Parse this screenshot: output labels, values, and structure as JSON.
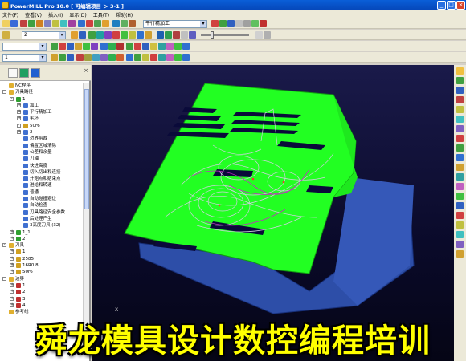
{
  "window": {
    "title": "PowerMILL Pro 10.0   [ 可编辑项目 ＞ 3-1 ]",
    "minimize": "_",
    "maximize": "□",
    "close": "×"
  },
  "menu": [
    "文件(F)",
    "查看(V)",
    "插入(I)",
    "显示(D)",
    "工具(T)",
    "帮助(H)"
  ],
  "toolbar": {
    "strategy_dropdown": "平行精加工",
    "layer_dropdown": "2",
    "tool_dropdown": "1"
  },
  "tree": {
    "rows": [
      {
        "level": 0,
        "exp": "",
        "label": "NC程序",
        "icon": "folder"
      },
      {
        "level": 0,
        "exp": "-",
        "label": "刀具路径",
        "icon": "folder"
      },
      {
        "level": 1,
        "exp": "-",
        "label": "1",
        "icon": "toolpath"
      },
      {
        "level": 2,
        "exp": "+",
        "label": "加工",
        "icon": "gear"
      },
      {
        "level": 2,
        "exp": "+",
        "label": "平行精加工",
        "icon": "gear"
      },
      {
        "level": 2,
        "exp": "+",
        "label": "毛坯",
        "icon": "gear"
      },
      {
        "level": 2,
        "exp": "-",
        "label": "50r6",
        "icon": "tool"
      },
      {
        "level": 2,
        "exp": "+",
        "label": "2",
        "icon": "gear"
      },
      {
        "level": 2,
        "exp": "",
        "label": "边界剪裁",
        "icon": "gear"
      },
      {
        "level": 2,
        "exp": "",
        "label": "偏置区域清除",
        "icon": "gear"
      },
      {
        "level": 2,
        "exp": "",
        "label": "公差和余量",
        "icon": "gear"
      },
      {
        "level": 2,
        "exp": "",
        "label": "刀轴",
        "icon": "gear"
      },
      {
        "level": 2,
        "exp": "",
        "label": "快进高度",
        "icon": "gear"
      },
      {
        "level": 2,
        "exp": "",
        "label": "切入切出和连接",
        "icon": "gear"
      },
      {
        "level": 2,
        "exp": "",
        "label": "开始点和结束点",
        "icon": "gear"
      },
      {
        "level": 2,
        "exp": "",
        "label": "进给和转速",
        "icon": "gear"
      },
      {
        "level": 2,
        "exp": "",
        "label": "普通",
        "icon": "gear"
      },
      {
        "level": 2,
        "exp": "",
        "label": "自动碰撞避让",
        "icon": "gear"
      },
      {
        "level": 2,
        "exp": "",
        "label": "自动检查",
        "icon": "gear"
      },
      {
        "level": 2,
        "exp": "",
        "label": "刀具路径安全参数",
        "icon": "gear"
      },
      {
        "level": 2,
        "exp": "",
        "label": "后处理产生",
        "icon": "gear"
      },
      {
        "level": 2,
        "exp": "",
        "label": "3高度刀具 (32)",
        "icon": "gear"
      },
      {
        "level": 1,
        "exp": "+",
        "label": "1_1",
        "icon": "toolpath"
      },
      {
        "level": 1,
        "exp": "+",
        "label": "2",
        "icon": "toolpath"
      },
      {
        "level": 0,
        "exp": "-",
        "label": "刀具",
        "icon": "folder"
      },
      {
        "level": 1,
        "exp": "+",
        "label": "1",
        "icon": "tool"
      },
      {
        "level": 1,
        "exp": "+",
        "label": "2585",
        "icon": "tool"
      },
      {
        "level": 1,
        "exp": "+",
        "label": "16R0.8",
        "icon": "tool"
      },
      {
        "level": 1,
        "exp": "+",
        "label": "50r6",
        "icon": "tool"
      },
      {
        "level": 0,
        "exp": "-",
        "label": "边界",
        "icon": "folder"
      },
      {
        "level": 1,
        "exp": "+",
        "label": "1",
        "icon": "boundary"
      },
      {
        "level": 1,
        "exp": "+",
        "label": "2",
        "icon": "boundary"
      },
      {
        "level": 1,
        "exp": "+",
        "label": "3",
        "icon": "boundary"
      },
      {
        "level": 1,
        "exp": "+",
        "label": "4",
        "icon": "boundary"
      },
      {
        "level": 0,
        "exp": "",
        "label": "参考线",
        "icon": "folder"
      }
    ]
  },
  "viewport": {
    "axis_x": "X"
  },
  "banner": {
    "text": "舜龙模具设计数控编程培训"
  },
  "colors": {
    "part_green": "#22ff22",
    "part_blue": "#3a5ec8",
    "background": "#0a0a2a",
    "banner": "#ffff00"
  }
}
